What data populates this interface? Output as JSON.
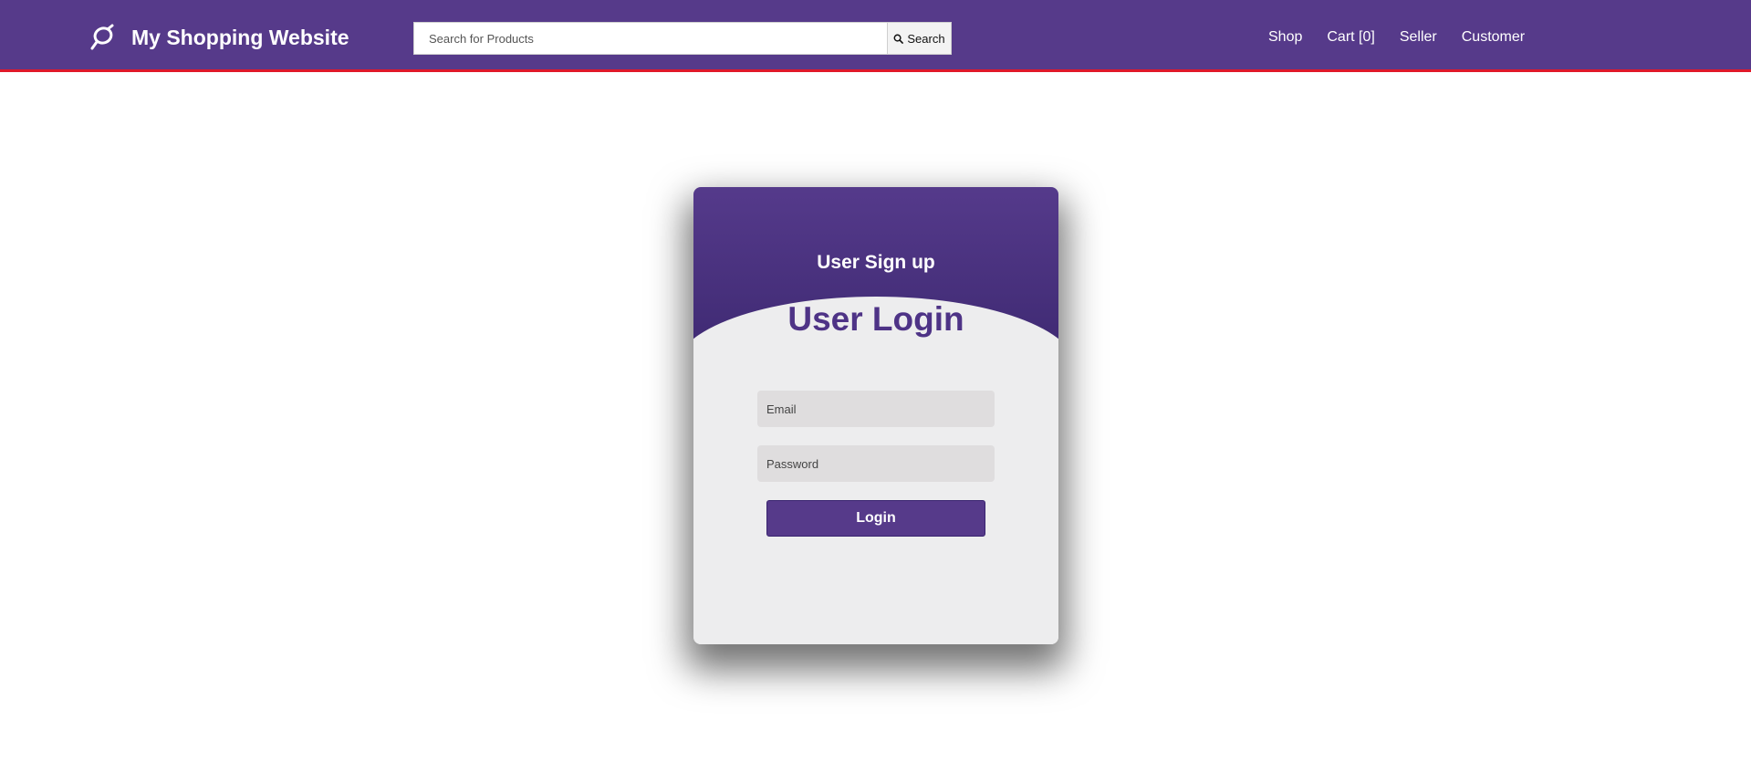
{
  "header": {
    "brand_name": "My Shopping Website",
    "brand_icon": "brand-logo-icon",
    "search": {
      "placeholder": "Search for Products",
      "value": "",
      "button_label": "Search",
      "button_icon": "search-icon"
    },
    "nav": [
      {
        "label": "Shop"
      },
      {
        "label": "Cart [0]"
      },
      {
        "label": "Seller"
      },
      {
        "label": "Customer"
      }
    ]
  },
  "login_card": {
    "signup_label": "User Sign up",
    "title": "User Login",
    "email_placeholder": "Email",
    "password_placeholder": "Password",
    "button_label": "Login"
  },
  "colors": {
    "brand_purple": "#563a8a",
    "accent_red": "#e0192a",
    "card_background": "#ededee",
    "input_background": "#dfddde"
  }
}
